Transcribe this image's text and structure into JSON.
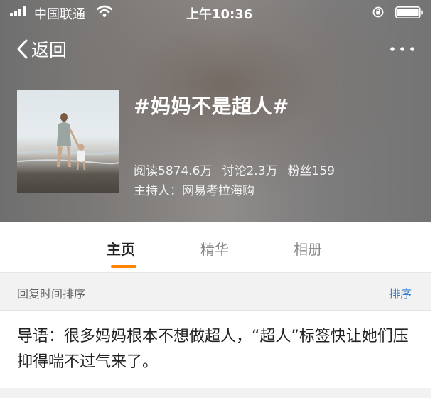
{
  "status_bar": {
    "carrier": "中国联通",
    "time": "上午10:36"
  },
  "nav": {
    "back_label": "返回",
    "more_icon": "more-dots-icon"
  },
  "topic": {
    "title": "#妈妈不是超人#",
    "stats": {
      "reads": "阅读5874.6万",
      "discussions": "讨论2.3万",
      "fans": "粉丝159"
    },
    "host": "主持人：网易考拉海购"
  },
  "tabs": [
    {
      "label": "主页",
      "active": true
    },
    {
      "label": "精华",
      "active": false
    },
    {
      "label": "相册",
      "active": false
    }
  ],
  "sort_bar": {
    "label": "回复时间排序",
    "button": "排序"
  },
  "intro": {
    "text": "导语：很多妈妈根本不想做超人，“超人”标签快让她们压抑得喘不过气来了。"
  },
  "colors": {
    "accent_orange": "#ff8200",
    "link_blue": "#3b7cc9"
  }
}
